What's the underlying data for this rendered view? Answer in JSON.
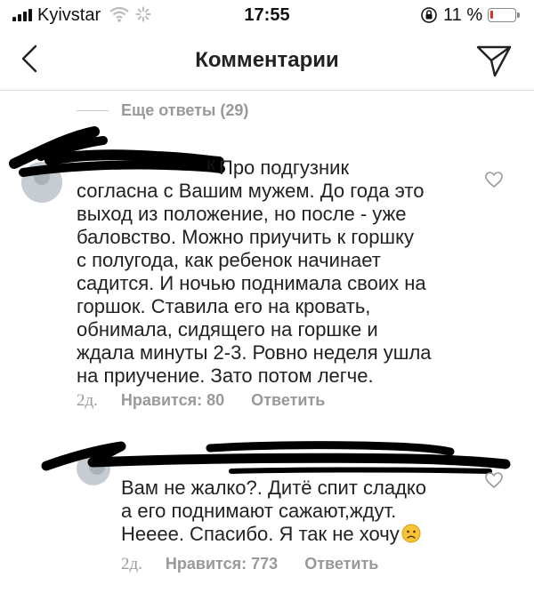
{
  "status_bar": {
    "carrier": "Kyivstar",
    "time": "17:55",
    "battery_percent": "11 %",
    "battery_level": 0.11,
    "battery_color": "#e0301e"
  },
  "header": {
    "title": "Комментарии",
    "back_icon": "chevron-left-icon",
    "share_icon": "paper-plane-icon"
  },
  "more_replies": {
    "label": "Еще ответы (29)"
  },
  "comments": [
    {
      "username_suffix": "к",
      "text": "Про подгузник\nсогласна с Вашим мужем. До года это\nвыход из положение, но после - уже\nбаловство. Можно приучить к горшку\nс полугода, как ребенок начинает\nсадится. И ночью поднимала своих на\nгоршок. Ставила его на кровать,\nобнимала, сидящего на горшке и\nждала минуты 2-3. Ровно неделя ушла\nна приучение. Зато потом легче.",
      "time": "2д.",
      "likes": "Нравится: 80",
      "reply": "Ответить"
    },
    {
      "username_suffix": "",
      "text": "Вам не жалко?. Дитё спит сладко\nа его поднимают сажают,ждут.\nНееее. Спасибо. Я так не хочу",
      "emoji": "slightly-frowning-face-icon",
      "time": "2д.",
      "likes": "Нравится: 773",
      "reply": "Ответить"
    }
  ]
}
